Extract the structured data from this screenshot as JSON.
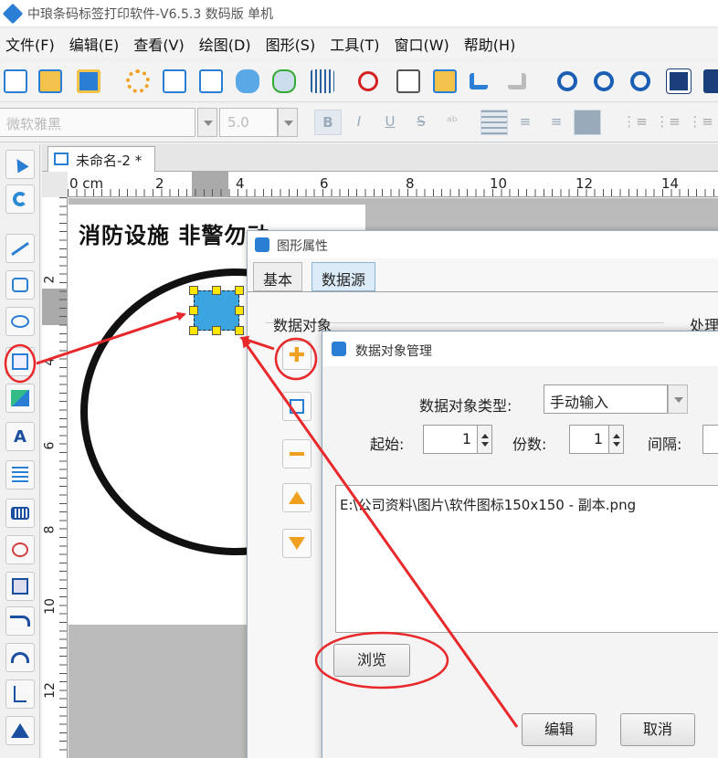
{
  "window": {
    "title": "中琅条码标签打印软件-V6.5.3 数码版 单机"
  },
  "menu": [
    "文件(F)",
    "编辑(E)",
    "查看(V)",
    "绘图(D)",
    "图形(S)",
    "工具(T)",
    "窗口(W)",
    "帮助(H)"
  ],
  "font_toolbar": {
    "font_name": "微软雅黑",
    "font_size": "5.0",
    "bold": "B",
    "italic": "I",
    "underline": "U",
    "strike": "S"
  },
  "document": {
    "tab_title": "未命名-2 *",
    "page_title_text": "消防设施  非警勿动"
  },
  "ruler": {
    "top_ticks": [
      "0 cm",
      "2",
      "4",
      "6",
      "8",
      "10",
      "12",
      "14"
    ],
    "left_ticks": [
      "2",
      "4",
      "6",
      "8",
      "10",
      "12"
    ]
  },
  "left_tools": {
    "text_tool": "A"
  },
  "prop_dialog": {
    "title": "图形属性",
    "tabs": [
      "基本",
      "数据源"
    ],
    "data_object_label": "数据对象",
    "process_label": "处理"
  },
  "mgr_dialog": {
    "title": "数据对象管理",
    "type_label": "数据对象类型:",
    "type_value": "手动输入",
    "start_label": "起始:",
    "start_value": "1",
    "copies_label": "份数:",
    "copies_value": "1",
    "interval_label": "间隔:",
    "path_text": "E:\\公司资料\\图片\\软件图标150x150 - 副本.png",
    "browse_button": "浏览",
    "edit_button": "编辑",
    "cancel_button": "取消"
  },
  "colors": {
    "accent": "#2a7fd4",
    "annotation_red": "#e8282a",
    "handle_yellow": "#ffe600"
  }
}
